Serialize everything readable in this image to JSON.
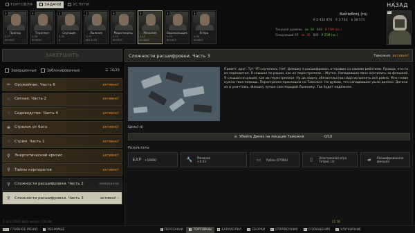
{
  "top_tabs": [
    {
      "label": "ТОРГОВЛЯ",
      "active": false
    },
    {
      "label": "ЗАДАЧИ",
      "active": true
    },
    {
      "label": "УСЛУГИ",
      "active": false
    }
  ],
  "back_label": "НАЗАД",
  "traders": [
    {
      "name": "Прапор",
      "level": "3",
      "stat1": "0.77",
      "stat2": "804443",
      "selected": false
    },
    {
      "name": "Терапевт",
      "level": "3",
      "stat1": "0.96",
      "stat2": "804843",
      "selected": false
    },
    {
      "name": "Скупщик",
      "level": "1",
      "stat1": "0.35",
      "stat2": "0",
      "selected": false
    },
    {
      "name": "Лыжник",
      "level": "2",
      "stat1": "0.35",
      "stat2": "8813228",
      "selected": false
    },
    {
      "name": "Миротворец",
      "level": "3",
      "stat1": "0.54",
      "stat2": "804445",
      "selected": false
    },
    {
      "name": "Механик",
      "level": "3",
      "stat1": "0.42",
      "stat2": "804843",
      "selected": true
    },
    {
      "name": "Барахольщик",
      "level": "3",
      "stat1": "0.55",
      "stat2": "804443",
      "selected": false
    },
    {
      "name": "Егерь",
      "level": "3",
      "stat1": "0.38",
      "stat2": "804843",
      "selected": false
    }
  ],
  "player": {
    "nickname": "BattleBonj (ru)",
    "level": "36",
    "rub": "₽ 2 432 876",
    "eur": "€ 2 763",
    "usd": "$ 38 571",
    "current_label": "Текущий уровень",
    "current_value": "ок. 34",
    "current_score": "843",
    "current_money": "₽ 73М (ок.)",
    "next_label": "Следующий УЛ",
    "next_value": "ок. 36",
    "next_score": "846",
    "next_money": "₽ 25М (ок.)"
  },
  "complete_button": "ЗАВЕРШИТЬ",
  "filters": {
    "finished": "Завершенные",
    "blocked": "Заблокированные",
    "count": "14/23"
  },
  "quests": [
    {
      "icon": "wrench-icon",
      "glyph": "✂",
      "title": "Оружейник. Часть 6",
      "status": "активно!",
      "dim": false,
      "selected": false
    },
    {
      "icon": "hand-icon",
      "glyph": "☜",
      "title": "Сигнал. Часть 2",
      "status": "активно!",
      "dim": false,
      "selected": false
    },
    {
      "icon": "hand-icon",
      "glyph": "☜",
      "title": "Садоводство. Часть 4",
      "status": "активно!",
      "dim": false,
      "selected": false
    },
    {
      "icon": "crosshair-icon",
      "glyph": "⊕",
      "title": "Стрелок от бога",
      "status": "активно!",
      "dim": false,
      "selected": false
    },
    {
      "icon": "hand-icon",
      "glyph": "☜",
      "title": "Стрим. Часть 1",
      "status": "активно!",
      "dim": false,
      "selected": false
    },
    {
      "icon": "search-icon",
      "glyph": "⚲",
      "title": "Энергетический кризис",
      "status": "активно!",
      "dim": false,
      "selected": false
    },
    {
      "icon": "search-icon",
      "glyph": "⚲",
      "title": "Тайны корпоратов",
      "status": "активно!",
      "dim": false,
      "selected": false
    },
    {
      "icon": "map-pin-icon",
      "glyph": "⚲",
      "title": "Сложности расшифровки. Часть 2",
      "status": "завершено",
      "dim": true,
      "selected": false
    },
    {
      "icon": "search-icon",
      "glyph": "⚲",
      "title": "Сложности расшифровки. Часть 3",
      "status": "активно! ›",
      "dim": false,
      "selected": true
    }
  ],
  "detail": {
    "title": "Сложности расшифровки. Часть 3",
    "location": "Таможня",
    "status": "активно!",
    "text": "Привет, друг. Тут ЧП случилось. Нет, флешку я расшифровал, отправил со своими ребятами. Правда, кто-то их перехватил. Я слышал по рации, как их перестреляли... Жутко. Нападавшие явно охотились за флешкой. Я слышал по рации, как их перестреляли. Ну да ладно, обязательства надо исполнять всё равно. Мне снова нужна твоя помощь. Перестрелка произошла на Таможне. Не думаю, что нападавшие ушли далеко. Догони их и уничтожь. Флешку лучше сам передай Лыжнику. Так будет надёжнее.",
    "goals_label": "Цель(-и)",
    "objective": "Убейте Диких на локации Таможня",
    "objective_progress": "0/10",
    "rewards_label": "Результаты",
    "rewards": [
      {
        "icon": "exp-icon",
        "glyph": "EXP",
        "title": "+16000",
        "sub": ""
      },
      {
        "icon": "wrench-icon",
        "glyph": "🔧",
        "title": "Механик",
        "sub": "+0.03"
      },
      {
        "icon": "item-icon",
        "glyph": "▭",
        "title": "Рубли (57084)",
        "sub": ""
      },
      {
        "icon": "item-icon",
        "glyph": "▯",
        "title": "Электронная игра",
        "sub": "Тетрис (3)"
      },
      {
        "icon": "flash-drive-icon",
        "glyph": "▰",
        "title": "Расшифрованная",
        "sub": "флешка"
      }
    ]
  },
  "bottom_bar": [
    {
      "key": "ESC",
      "label": "ГЛАВНОЕ МЕНЮ",
      "active": false
    },
    {
      "key": "F",
      "label": "УБЕЖИЩЕ",
      "active": false
    },
    {
      "key": "P",
      "label": "ПЕРСОНАЖ",
      "active": false
    },
    {
      "key": "T",
      "label": "ТОРГОВЦЫ",
      "active": true
    },
    {
      "key": "B",
      "label": "БАРАХОЛКА",
      "active": false
    },
    {
      "key": "N",
      "label": "СБОРКИ",
      "active": false
    },
    {
      "key": "H",
      "label": "СПРАВОЧНИК",
      "active": false
    },
    {
      "key": "M",
      "label": "СООБЩЕНИЯ",
      "active": false
    },
    {
      "key": "U",
      "label": "УЛУЧШЕНИЕ",
      "active": false
    }
  ],
  "version": "0.12.8.20937 Beta version | 4hL4W",
  "clock": "21:59"
}
